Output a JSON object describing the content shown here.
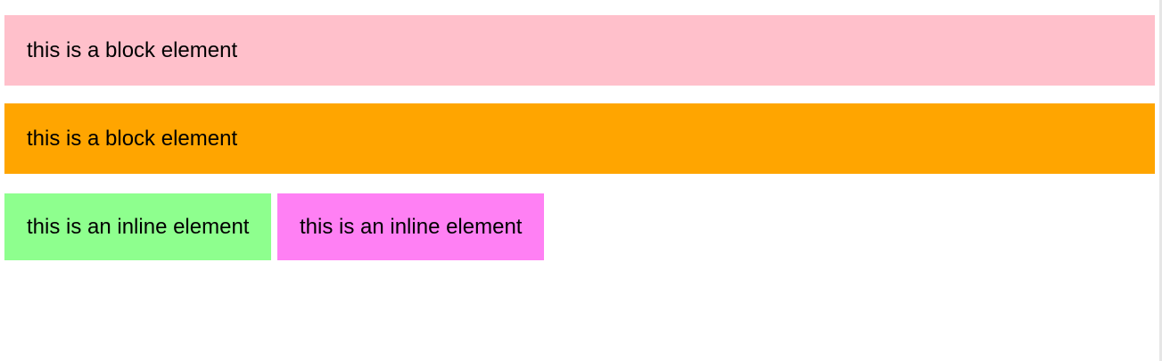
{
  "blocks": [
    {
      "label": "this is a block element",
      "color": "#ffc0cb"
    },
    {
      "label": "this is a block element",
      "color": "#ffa500"
    }
  ],
  "inlines": [
    {
      "label": "this is an inline element",
      "color": "#8eff8e"
    },
    {
      "label": "this is an inline element",
      "color": "#ff80f4"
    }
  ]
}
